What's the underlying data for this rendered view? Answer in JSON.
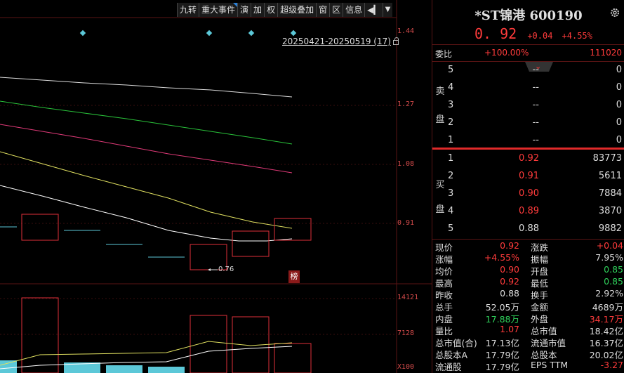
{
  "toolbar": {
    "items": [
      "九转",
      "重大事件",
      "演",
      "加",
      "权",
      "超级叠加",
      "窗",
      "区",
      "信息"
    ],
    "more_icon": "play-left-icon",
    "dropdown_icon": "triangle-down-icon"
  },
  "chart": {
    "range_label": "20250421-20250519 (17)",
    "axis_labels": [
      "1.44",
      "1.27",
      "1.08",
      "0.91"
    ],
    "volume_axis_labels": [
      "14121",
      "7128",
      "X100"
    ],
    "low_marker": "0.76",
    "badge": "榜",
    "colors": {
      "up": "#e0303a",
      "down": "#5cc8d8",
      "ma5": "#ffffff",
      "ma10": "#e0e060",
      "ma20": "#e03a78",
      "ma30": "#29c23a",
      "ma60": "#dddddd"
    }
  },
  "quote": {
    "title": "*ST锦港 600190",
    "price": "0. 92",
    "change": "+0.04",
    "change_pct": "+4.55%",
    "weibi_label": "委比",
    "weibi_pct": "+100.00%",
    "weicha": "111020",
    "sell_label": [
      "卖",
      "盘"
    ],
    "buy_label": [
      "买",
      "盘"
    ],
    "sell": [
      {
        "lvl": "5",
        "px": "--",
        "vol": "0"
      },
      {
        "lvl": "4",
        "px": "--",
        "vol": "0"
      },
      {
        "lvl": "3",
        "px": "--",
        "vol": "0"
      },
      {
        "lvl": "2",
        "px": "--",
        "vol": "0"
      },
      {
        "lvl": "1",
        "px": "--",
        "vol": "0"
      }
    ],
    "buy": [
      {
        "lvl": "1",
        "px": "0.92",
        "vol": "83773",
        "c": "red"
      },
      {
        "lvl": "2",
        "px": "0.91",
        "vol": "5611",
        "c": "red"
      },
      {
        "lvl": "3",
        "px": "0.90",
        "vol": "7884",
        "c": "red"
      },
      {
        "lvl": "4",
        "px": "0.89",
        "vol": "3870",
        "c": "red"
      },
      {
        "lvl": "5",
        "px": "0.88",
        "vol": "9882",
        "c": "white"
      }
    ],
    "stats": [
      {
        "k1": "现价",
        "v1": "0.92",
        "c1": "red",
        "k2": "涨跌",
        "v2": "+0.04",
        "c2": "red"
      },
      {
        "k1": "涨幅",
        "v1": "+4.55%",
        "c1": "red",
        "k2": "振幅",
        "v2": "7.95%",
        "c2": "white"
      },
      {
        "k1": "均价",
        "v1": "0.90",
        "c1": "red",
        "k2": "开盘",
        "v2": "0.85",
        "c2": "green"
      },
      {
        "k1": "最高",
        "v1": "0.92",
        "c1": "red",
        "k2": "最低",
        "v2": "0.85",
        "c2": "green"
      },
      {
        "k1": "昨收",
        "v1": "0.88",
        "c1": "white",
        "k2": "换手",
        "v2": "2.92%",
        "c2": "white"
      },
      {
        "k1": "总手",
        "v1": "52.05万",
        "c1": "white",
        "k2": "金额",
        "v2": "4689万",
        "c2": "white"
      },
      {
        "k1": "内盘",
        "v1": "17.88万",
        "c1": "green",
        "k2": "外盘",
        "v2": "34.17万",
        "c2": "red"
      },
      {
        "k1": "量比",
        "v1": "1.07",
        "c1": "red",
        "k2": "总市值",
        "v2": "18.42亿",
        "c2": "white"
      },
      {
        "k1": "总市值(合)",
        "v1": "17.13亿",
        "c1": "white",
        "k2": "流通市值",
        "v2": "16.37亿",
        "c2": "white"
      },
      {
        "k1": "总股本A",
        "v1": "17.79亿",
        "c1": "white",
        "k2": "总股本",
        "v2": "20.02亿",
        "c2": "white"
      },
      {
        "k1": "流通股",
        "v1": "17.79亿",
        "c1": "white",
        "k2": "EPS TTM",
        "v2": "-3.27",
        "c2": "red"
      }
    ]
  }
}
